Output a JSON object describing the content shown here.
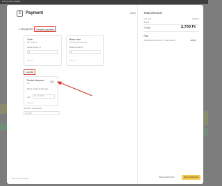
{
  "top_bar": {
    "text": "3 of 8 Q   Store ProSale"
  },
  "modal": {
    "title": "Payment",
    "close_label": "Close",
    "tabs": [
      {
        "label": "1 full payment"
      },
      {
        "label": "Detailed payment"
      }
    ],
    "cards": {
      "cash": {
        "title": "Cash",
        "subtitle": "Bank register",
        "amount_label": "Amount to pay, Ft",
        "amount_value": "0",
        "action": "Pay up"
      },
      "bank_card": {
        "title": "Bank card",
        "subtitle": "Card payment terminal",
        "amount_label": "Amount to pay, Ft",
        "amount_value": "0",
        "action": "Pay up"
      }
    },
    "loyalty": {
      "section_label": "Loyalty",
      "card_title": "Postal discount",
      "card_subtitle": "0%",
      "phone_label": "Phone number of the buyer",
      "phone_prefix": "+36",
      "phone_placeholder": "00 123 4567",
      "action": "Pay up"
    },
    "membership": {
      "label": "Gift card / membership",
      "placeholder": "Number"
    },
    "footer_left": "Maximum label usage",
    "summary": {
      "title": "Total amount",
      "subtotal_label": "Sub total",
      "subtotal_value": "2,699 Ft",
      "rounding_label": "Round",
      "total_label": "To pay",
      "total_value": "2,700 Ft",
      "paid_title": "Paid",
      "paid_row_label": "Postal discount (discount — Total discount)",
      "paid_row_value": "-180 Ft"
    },
    "buttons": {
      "secondary": "Delete appointment",
      "primary": "Issue appointment"
    }
  },
  "colors": {
    "highlight": "#d93a2b",
    "primary_button": "#f2c94c"
  }
}
